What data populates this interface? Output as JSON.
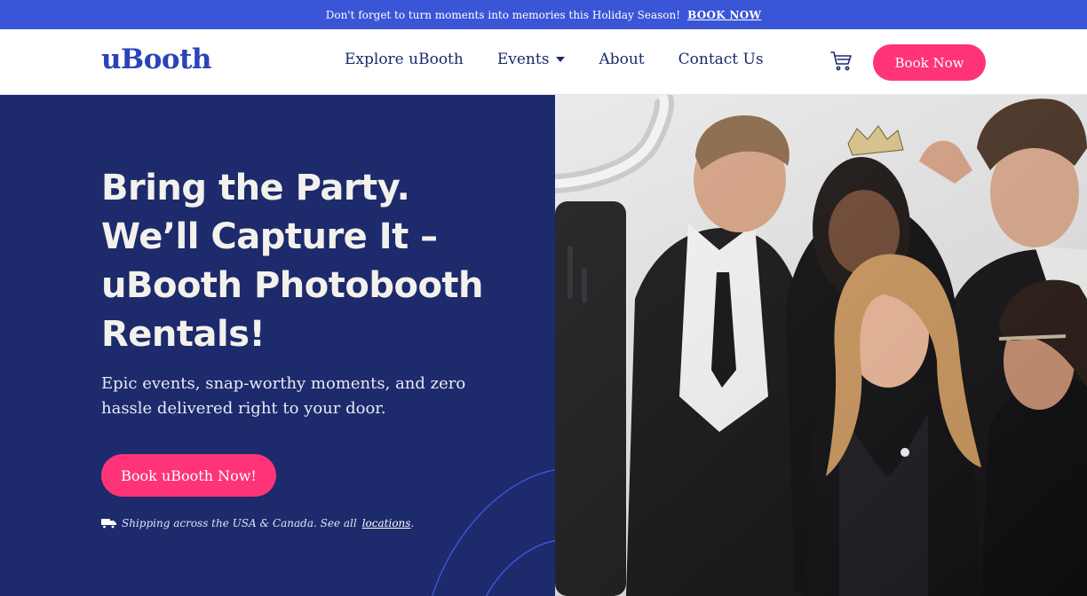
{
  "announcement": {
    "text": "Don't forget to turn moments into memories this Holiday Season!",
    "link": "BOOK NOW"
  },
  "header": {
    "logo": "uBooth",
    "nav": [
      {
        "label": "Explore uBooth"
      },
      {
        "label": "Events"
      },
      {
        "label": "About"
      },
      {
        "label": "Contact Us"
      }
    ],
    "cart_icon": "cart-icon",
    "cta": "Book Now"
  },
  "hero": {
    "title_lines": [
      "Bring the Party.",
      "We’ll Capture It –",
      "uBooth Photobooth",
      "Rentals!"
    ],
    "subtitle": "Epic events, snap-worthy moments, and zero hassle delivered right to your door.",
    "cta": "Book uBooth Now!",
    "shipping_text": "Shipping across the USA & Canada. See all",
    "shipping_link": "locations",
    "shipping_end": ".",
    "truck_icon": "truck-icon"
  },
  "colors": {
    "brand_blue": "#2c43b8",
    "navy": "#1d2a6c",
    "pink": "#ff3478",
    "announce_bar": "#3a55d6"
  }
}
